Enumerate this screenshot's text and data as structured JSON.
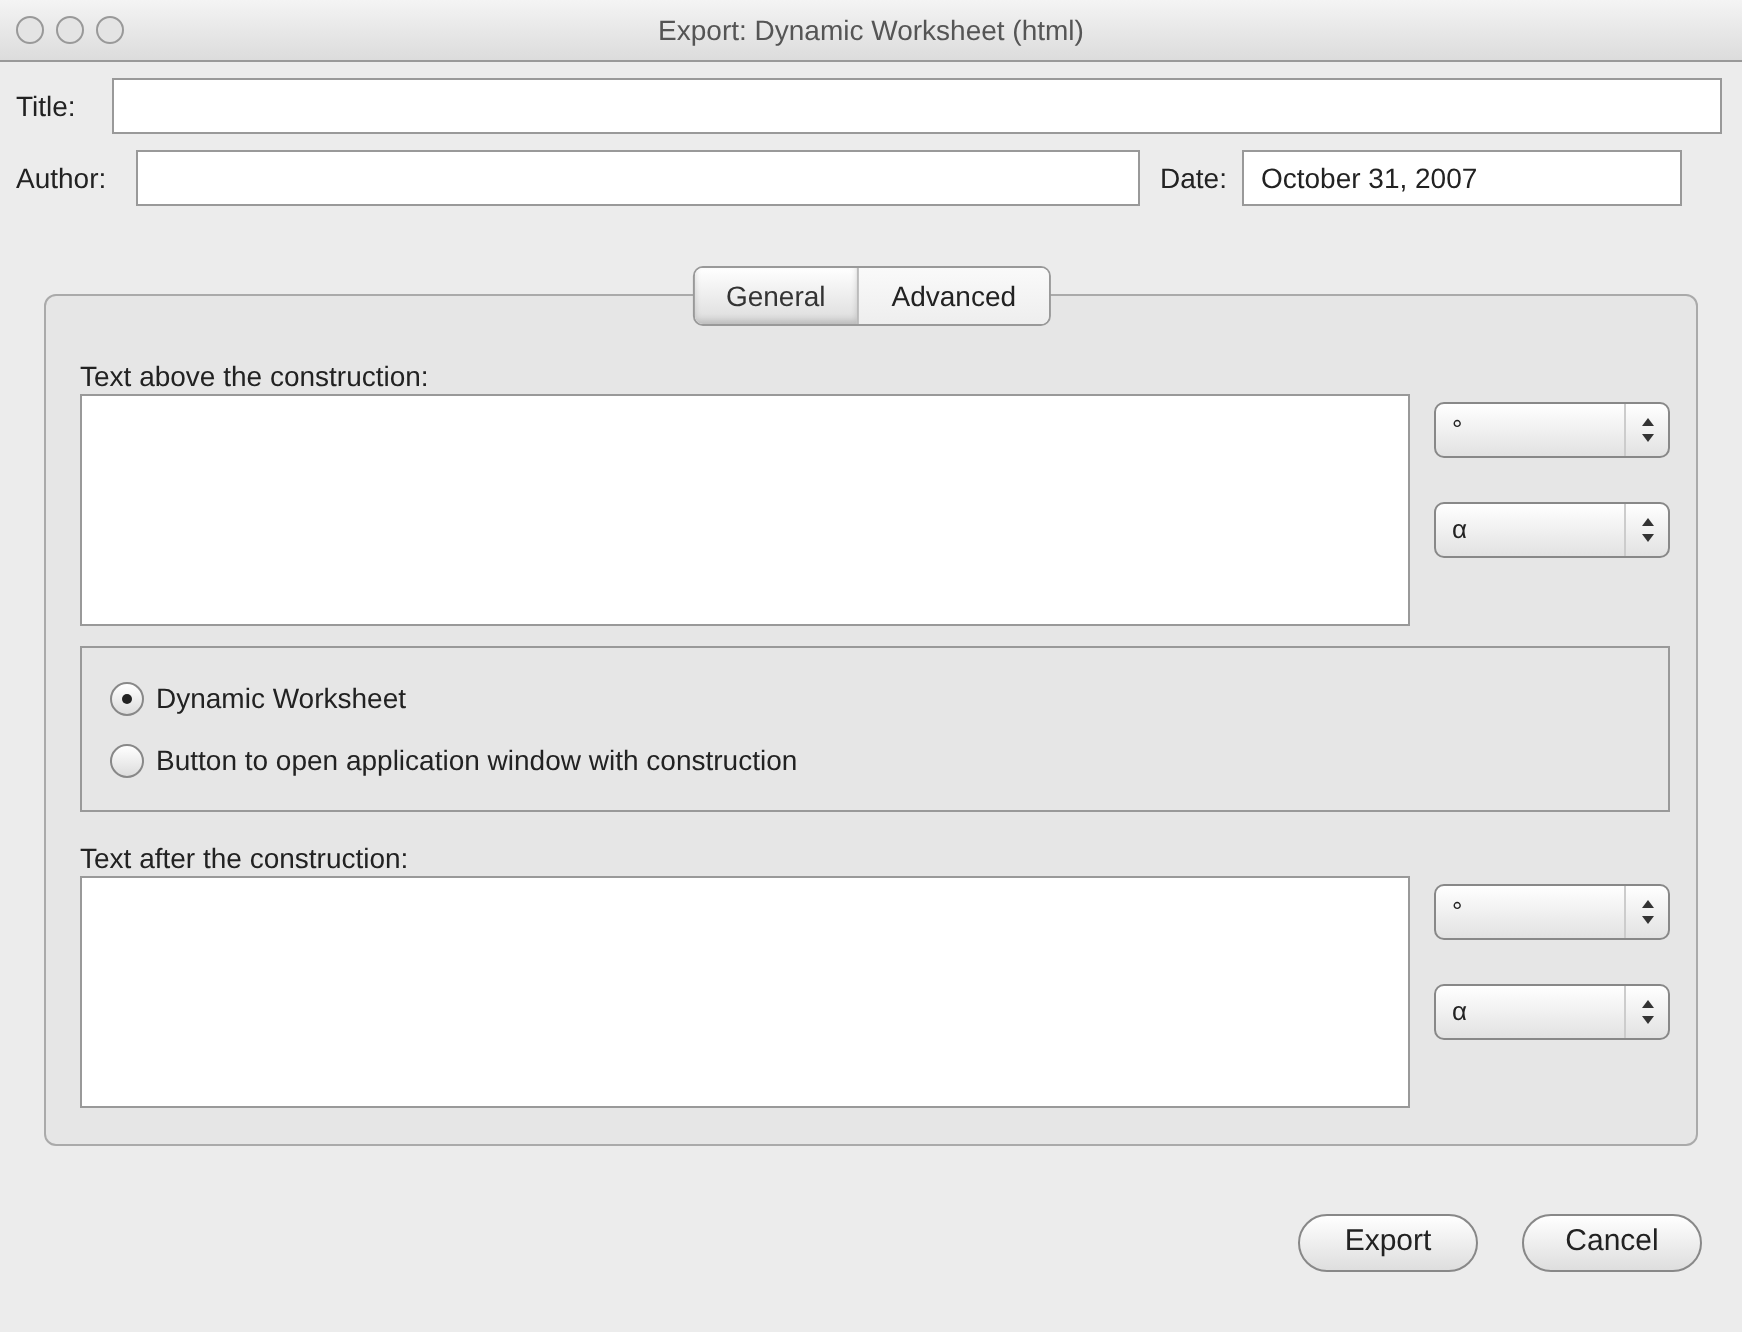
{
  "window": {
    "title": "Export: Dynamic Worksheet (html)"
  },
  "fields": [
    {
      "label": "Title:"
    },
    {
      "label": "Author:"
    },
    {
      "label": "Date:",
      "value": "October 31, 2007"
    }
  ],
  "tabs": [
    {
      "label": "General",
      "selected": true
    },
    {
      "label": "Advanced",
      "selected": false
    }
  ],
  "text_above": {
    "label": "Text above the construction:",
    "symbol_menus": [
      "°",
      "α"
    ]
  },
  "radios": [
    {
      "label": "Dynamic Worksheet",
      "selected": true
    },
    {
      "label": "Button to open application window with construction",
      "selected": false
    }
  ],
  "text_after": {
    "label": "Text after the construction:",
    "symbol_menus": [
      "°",
      "α"
    ]
  },
  "buttons": [
    "Export",
    "Cancel"
  ]
}
